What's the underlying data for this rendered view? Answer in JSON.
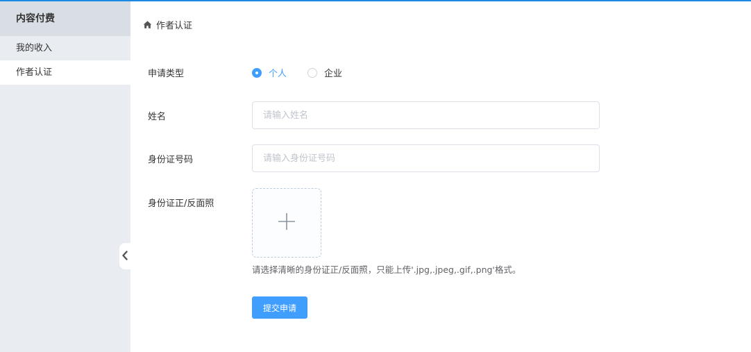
{
  "sidebar": {
    "header": "内容付费",
    "items": [
      {
        "label": "我的收入"
      },
      {
        "label": "作者认证"
      }
    ]
  },
  "breadcrumb": {
    "icon": "home-icon",
    "current": "作者认证"
  },
  "form": {
    "apply_type": {
      "label": "申请类型",
      "options": [
        "个人",
        "企业"
      ],
      "selected": "个人"
    },
    "name": {
      "label": "姓名",
      "placeholder": "请输入姓名",
      "value": ""
    },
    "id_number": {
      "label": "身份证号码",
      "placeholder": "请输入身份证号码",
      "value": ""
    },
    "id_photo": {
      "label": "身份证正/反面照",
      "tip": "请选择清晰的身份证正/反面照，只能上传'.jpg,.jpeg,.gif,.png'格式。"
    },
    "submit_label": "提交申请"
  },
  "colors": {
    "accent": "#409eff",
    "top_bar": "#1e88e5",
    "sidebar_bg": "#e9ecf1",
    "sidebar_header_bg": "#d9dde4"
  }
}
